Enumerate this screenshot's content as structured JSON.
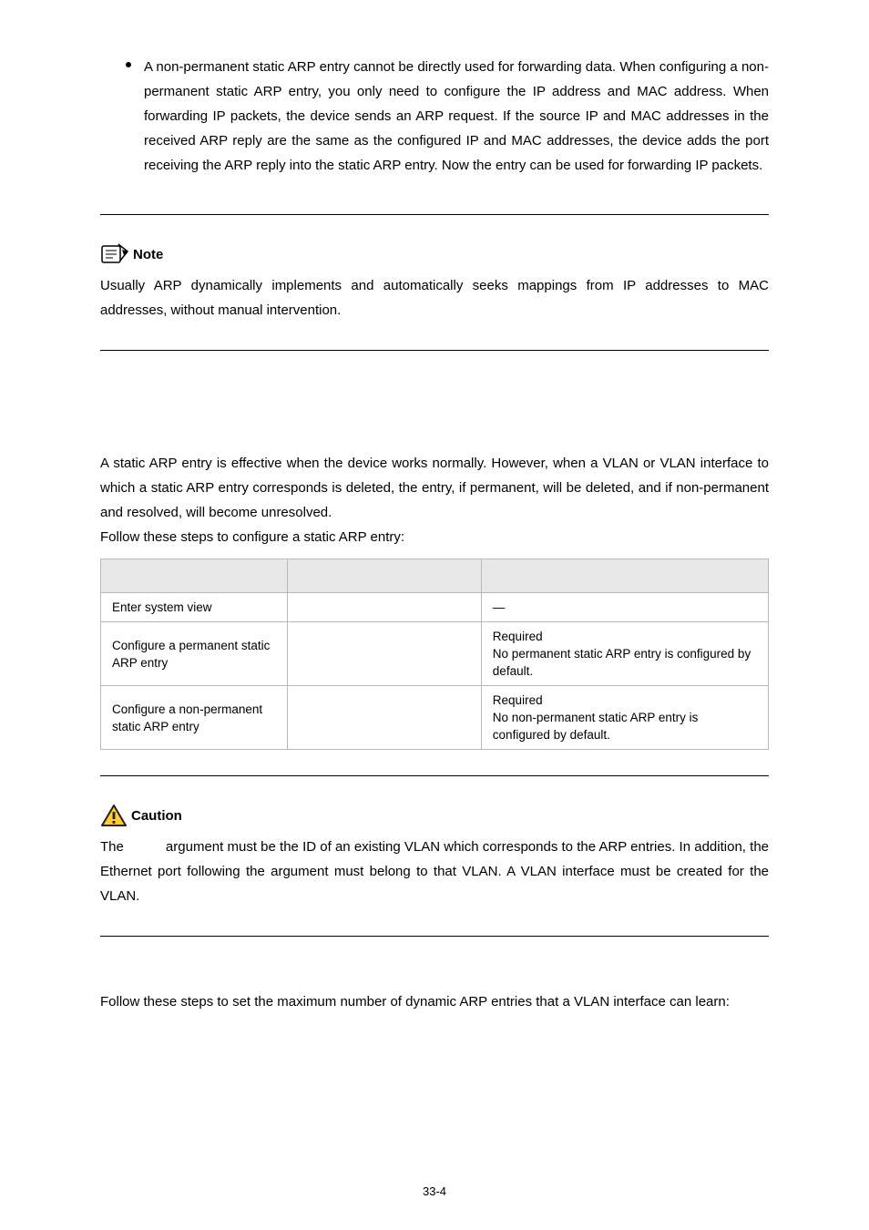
{
  "bullet_text": "A non-permanent static ARP entry cannot be directly used for forwarding data. When configuring a non-permanent static ARP entry, you only need to configure the IP address and MAC address. When forwarding IP packets, the device sends an ARP request. If the source IP and MAC addresses in the received ARP reply are the same as the configured IP and MAC addresses, the device adds the port receiving the ARP reply into the static ARP entry. Now the entry can be used for forwarding IP packets.",
  "note": {
    "label": "Note",
    "body": "Usually ARP dynamically implements and automatically seeks mappings from IP addresses to MAC addresses, without manual intervention."
  },
  "static_entry_intro": "A static ARP entry is effective when the device works normally. However, when a VLAN or VLAN interface to which a static ARP entry corresponds is deleted, the entry, if permanent, will be deleted, and if non-permanent and resolved, will become unresolved.",
  "steps_intro": "Follow these steps to configure a static ARP entry:",
  "table": {
    "rows": [
      {
        "c1": "Enter system view",
        "c2": "",
        "c3": "—"
      },
      {
        "c1": "Configure a permanent static ARP entry",
        "c2": "",
        "c3_line1": "Required",
        "c3_line2": "No permanent static ARP entry is configured by default."
      },
      {
        "c1": "Configure a non-permanent static ARP entry",
        "c2": "",
        "c3_line1": "Required",
        "c3_line2": "No non-permanent static ARP entry is configured by default."
      }
    ]
  },
  "caution": {
    "label": "Caution",
    "prefix": "The ",
    "suffix": " argument must be the ID of an existing VLAN which corresponds to the ARP entries. In addition, the Ethernet port following the argument must belong to that VLAN. A VLAN interface must be created for the VLAN."
  },
  "max_dynamic_intro": "Follow these steps to set the maximum number of dynamic ARP entries that a VLAN interface can learn:",
  "page_number": "33-4"
}
